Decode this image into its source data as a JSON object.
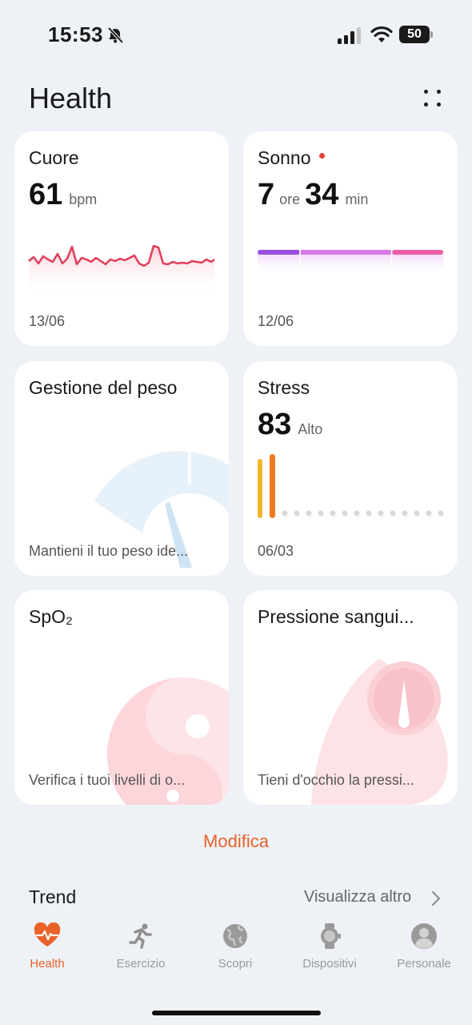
{
  "status_bar": {
    "time": "15:53",
    "battery": "50"
  },
  "header": {
    "title": "Health"
  },
  "cards": {
    "heart": {
      "title": "Cuore",
      "value": "61",
      "unit": "bpm",
      "date": "13/06"
    },
    "sleep": {
      "title": "Sonno",
      "hours": "7",
      "hours_unit": "ore",
      "minutes": "34",
      "minutes_unit": "min",
      "date": "12/06"
    },
    "weight": {
      "title": "Gestione del peso",
      "subtitle": "Mantieni il tuo peso ide..."
    },
    "stress": {
      "title": "Stress",
      "value": "83",
      "level": "Alto",
      "date": "06/03"
    },
    "spo2": {
      "title": "SpO₂",
      "subtitle": "Verifica i tuoi livelli di o..."
    },
    "pressure": {
      "title": "Pressione sangui...",
      "subtitle": "Tieni d'occhio la pressi..."
    }
  },
  "edit_label": "Modifica",
  "trend": {
    "title": "Trend",
    "more": "Visualizza altro"
  },
  "tabbar": [
    {
      "label": "Health",
      "icon": "heart-pulse-icon",
      "active": true
    },
    {
      "label": "Esercizio",
      "icon": "running-icon",
      "active": false
    },
    {
      "label": "Scopri",
      "icon": "globe-icon",
      "active": false
    },
    {
      "label": "Dispositivi",
      "icon": "watch-icon",
      "active": false
    },
    {
      "label": "Personale",
      "icon": "person-icon",
      "active": false
    }
  ],
  "colors": {
    "accent": "#e8622a",
    "heart_line": "#e23d5a",
    "sleep_deep": "#9b4fe0",
    "sleep_light": "#d77ae8",
    "sleep_rem": "#ea5fa6",
    "stress_yellow": "#f1b72c",
    "stress_orange": "#f07a1e"
  }
}
